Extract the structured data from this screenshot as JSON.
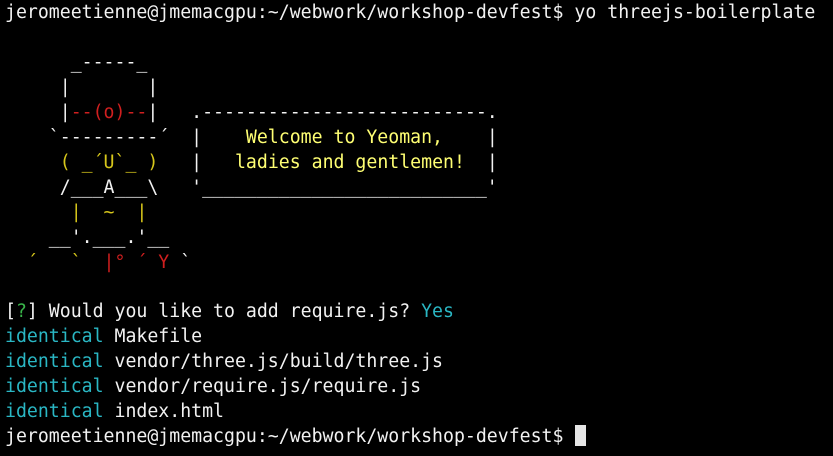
{
  "colors": {
    "background": "#000000",
    "text": "#f2f2f2",
    "cyan": "#2ab7c4",
    "green": "#39b54a",
    "yellow": "#ffff73",
    "red": "#d01f1f",
    "gold": "#d6c61b"
  },
  "prompt": {
    "text": "jeromeetienne@jmemacgpu:~/webwork/workshop-devfest$",
    "command": " yo threejs-boilerplate"
  },
  "art": {
    "l1_a": "      _-----_",
    "l2_a": "     |       |",
    "l3_a": "     |",
    "l3_b": "--(o)--",
    "l3_c": "|",
    "l3_d": "   .--------------------------.",
    "l4_a": "    `---------´",
    "l4_b": "  |",
    "l4_c": "    Welcome to Yeoman,    ",
    "l4_d": "|",
    "l5_a": "     ( _´U`_ )",
    "l5_b": "   |",
    "l5_c": "   ladies and gentlemen!  ",
    "l5_d": "|",
    "l6_a": "     /___A___\\",
    "l6_b": "   '__________________________'",
    "l7_a": "      |  ~  |",
    "l8_a": "    __'.___.'__",
    "l9_a": "  ´   ` ",
    "l9_b": " |° ´ Y",
    "l9_c": " `"
  },
  "question": {
    "open": "[",
    "mark": "?",
    "close": "]",
    "text": " Would you like to add require.js? ",
    "answer": "Yes"
  },
  "output": [
    {
      "status": "identical",
      "file": " Makefile"
    },
    {
      "status": "identical",
      "file": " vendor/three.js/build/three.js"
    },
    {
      "status": "identical",
      "file": " vendor/require.js/require.js"
    },
    {
      "status": "identical",
      "file": " index.html"
    }
  ],
  "final_prompt": {
    "text": "jeromeetienne@jmemacgpu:~/webwork/workshop-devfest$",
    "after": " "
  }
}
